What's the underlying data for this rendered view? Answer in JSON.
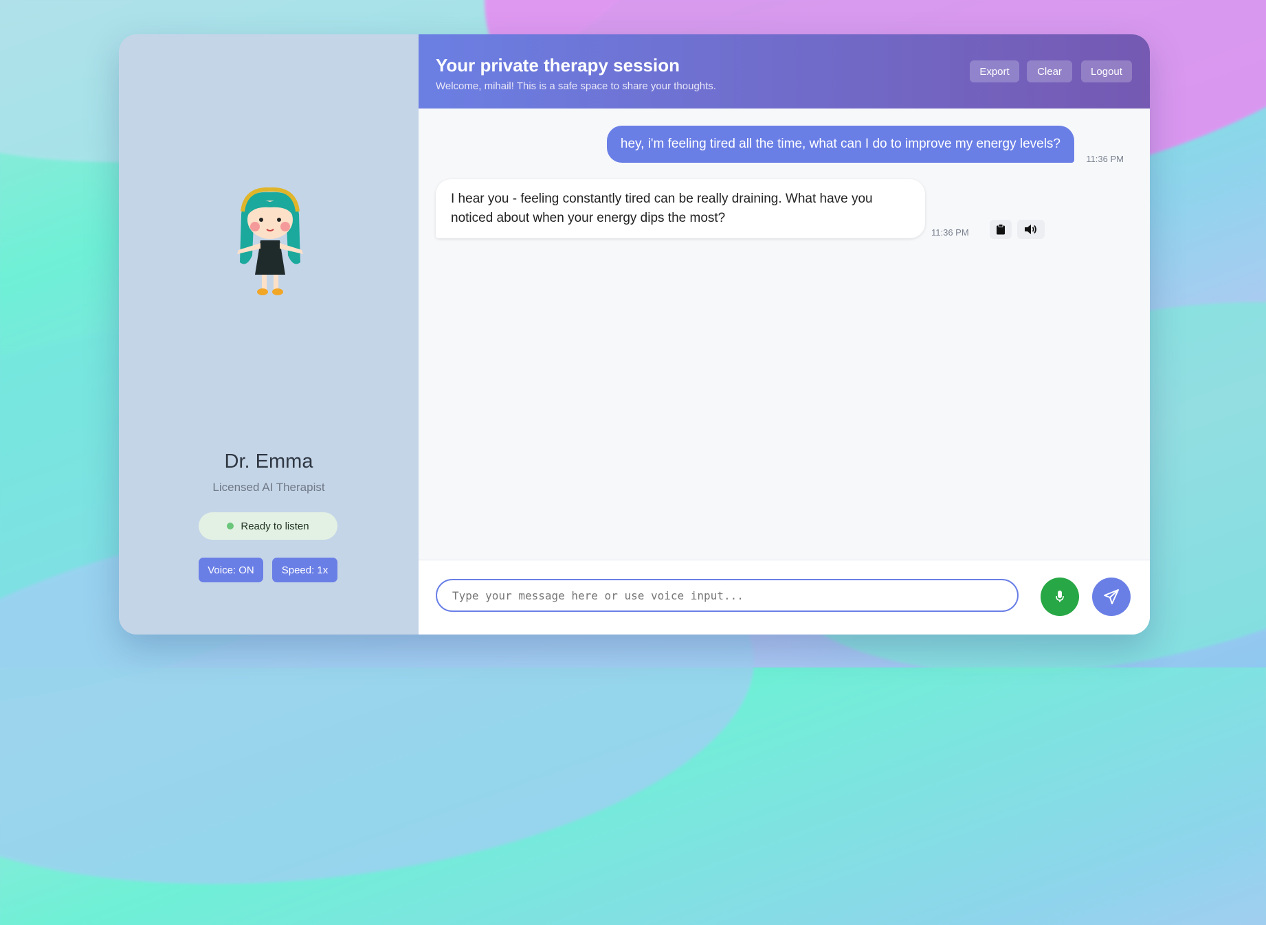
{
  "sidebar": {
    "doctor_name": "Dr. Emma",
    "doctor_role": "Licensed AI Therapist",
    "status": "Ready to listen",
    "voice_label": "Voice: ON",
    "speed_label": "Speed: 1x",
    "avatar_icon": "girl-avatar-icon"
  },
  "header": {
    "title": "Your private therapy session",
    "subtitle": "Welcome, mihail! This is a safe space to share your thoughts.",
    "export_label": "Export",
    "clear_label": "Clear",
    "logout_label": "Logout"
  },
  "messages": [
    {
      "role": "user",
      "text": "hey, i'm feeling tired all the time, what can I do to improve my energy levels?",
      "time": "11:36 PM"
    },
    {
      "role": "assistant",
      "text": "I hear you - feeling constantly tired can be really draining. What have you noticed about when your energy dips the most?",
      "time": "11:36 PM"
    }
  ],
  "composer": {
    "placeholder": "Type your message here or use voice input..."
  },
  "colors": {
    "accent": "#6a7fe6",
    "header_start": "#6b7fe3",
    "header_end": "#7559b2",
    "mic": "#27a745",
    "status_dot": "#6ac67a"
  }
}
